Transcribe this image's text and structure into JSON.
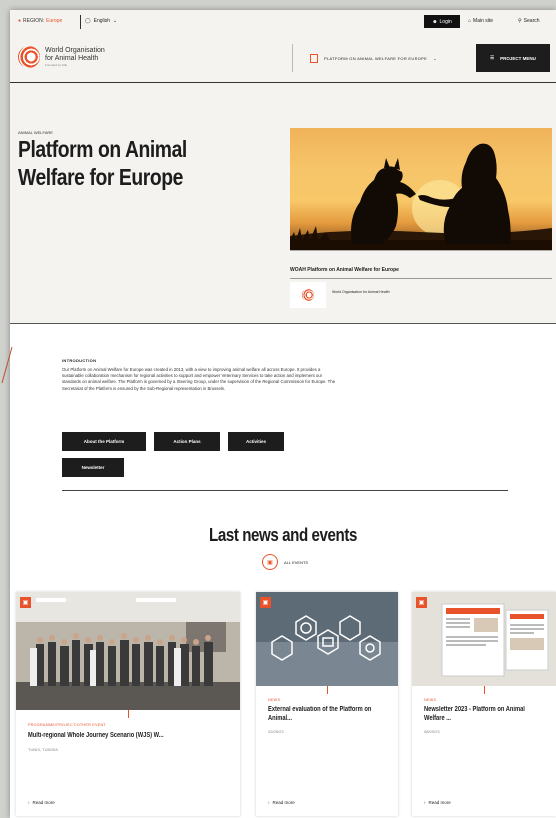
{
  "topbar": {
    "region_label": "REGION:",
    "region_value": "Europe",
    "language": "English",
    "login": "Login",
    "main_site": "Main site",
    "search": "Search"
  },
  "header": {
    "logo_line1": "World Organisation",
    "logo_line2": "for Animal Health",
    "logo_sub": "Founded as OIE",
    "platform_menu": "PLATFORM ON ANIMAL WELFARE FOR EUROPE",
    "project_menu": "PROJECT MENU"
  },
  "hero": {
    "breadcrumb": "ANIMAL WELFARE",
    "title": "Platform on Animal Welfare for Europe",
    "card_title": "WOAH Platform on Animal Welfare for Europe",
    "credit": "World Organisation for Animal Health"
  },
  "intro": {
    "label": "INTRODUCTION",
    "text": "Our Platform on Animal Welfare for Europe was created in 2013, with a view to improving animal welfare all across Europe. It provides a sustainable collaboration mechanism for regional activities to support and empower Veterinary Services to take action and implement our standards on animal welfare. The Platform is governed by a Steering Group, under the supervision of the Regional Commission for Europe. The Secretariat of the Platform is ensured by the Sub-Regional representation in Brussels.",
    "buttons": [
      "About the Platform",
      "Action Plans",
      "Activities",
      "Newsletter"
    ]
  },
  "news": {
    "title": "Last news and events",
    "all_events": "ALL EVENTS",
    "cards": [
      {
        "category": "PROGRAMME/PROJECT/OTHER EVENT",
        "title": "Multi-regional Whole Journey Scenario (WJS) W...",
        "sub": "TUNIS, TUNISIA",
        "more": "Read more"
      },
      {
        "category": "NEWS",
        "title": "External evaluation of the Platform on Animal...",
        "sub": "02/09/23",
        "more": "Read more"
      },
      {
        "category": "NEWS",
        "title": "Newsletter 2023 - Platform on Animal Welfare ...",
        "sub": "08/09/23",
        "more": "Read more"
      }
    ]
  },
  "colors": {
    "accent": "#e8532b",
    "dark": "#1d1d1d",
    "bg": "#f4f3ef"
  }
}
